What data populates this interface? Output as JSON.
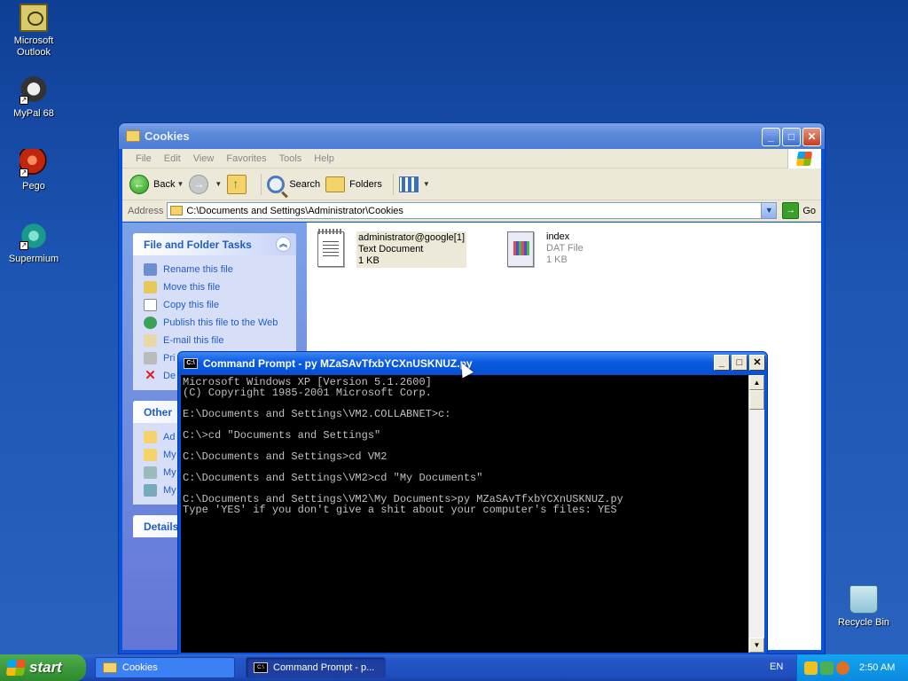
{
  "desktop": {
    "icons": [
      {
        "label_line1": "Microsoft",
        "label_line2": "Outlook",
        "icon": "outlook-icon"
      },
      {
        "label_line1": "MyPal 68",
        "icon": "mypal-icon"
      },
      {
        "label_line1": "Pego",
        "icon": "pego-icon"
      },
      {
        "label_line1": "Supermium",
        "icon": "supermium-icon"
      },
      {
        "label_line1": "Recycle Bin",
        "icon": "recycle-bin-icon"
      }
    ]
  },
  "explorer": {
    "title": "Cookies",
    "menu": [
      "File",
      "Edit",
      "View",
      "Favorites",
      "Tools",
      "Help"
    ],
    "toolbar": {
      "back": "Back",
      "search": "Search",
      "folders": "Folders"
    },
    "address": {
      "label": "Address",
      "value": "C:\\Documents and Settings\\Administrator\\Cookies",
      "go": "Go"
    },
    "tasks": {
      "file_folder_title": "File and Folder Tasks",
      "items": [
        "Rename this file",
        "Move this file",
        "Copy this file",
        "Publish this file to the Web",
        "E-mail this file",
        "Pri",
        "De"
      ],
      "other_title": "Other",
      "other_items": [
        "Ad",
        "My",
        "My",
        "My"
      ],
      "details_title": "Details"
    },
    "files": [
      {
        "name": "administrator@google[1]",
        "type": "Text Document",
        "size": "1 KB"
      },
      {
        "name": "index",
        "type": "DAT File",
        "size": "1 KB"
      }
    ]
  },
  "cmd": {
    "title": "Command Prompt - py MZaSAvTfxbYCXnUSKNUZ.py",
    "lines": [
      "Microsoft Windows XP [Version 5.1.2600]",
      "(C) Copyright 1985-2001 Microsoft Corp.",
      "",
      "E:\\Documents and Settings\\VM2.COLLABNET>c:",
      "",
      "C:\\>cd \"Documents and Settings\"",
      "",
      "C:\\Documents and Settings>cd VM2",
      "",
      "C:\\Documents and Settings\\VM2>cd \"My Documents\"",
      "",
      "C:\\Documents and Settings\\VM2\\My Documents>py MZaSAvTfxbYCXnUSKNUZ.py",
      "Type 'YES' if you don't give a shit about your computer's files: YES"
    ]
  },
  "taskbar": {
    "start": "start",
    "buttons": [
      "Cookies",
      "Command Prompt - p..."
    ],
    "language": "EN",
    "time": "2:50 AM"
  }
}
